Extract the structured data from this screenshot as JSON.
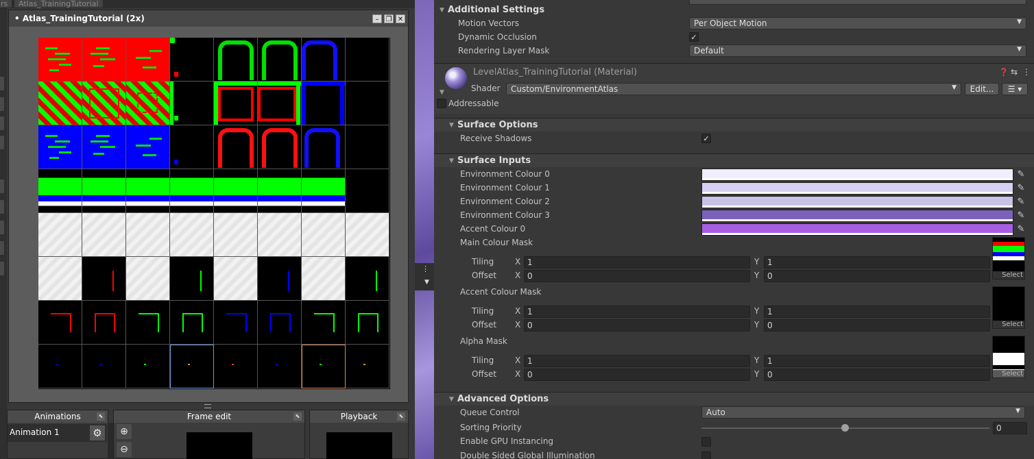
{
  "left_editor": {
    "top_tabs": [
      "rs",
      "Atlas_TrainingTutorial"
    ],
    "window_title": "• Atlas_TrainingTutorial   (2x)",
    "window_buttons": [
      "minimize-icon",
      "restore-icon",
      "close-icon"
    ],
    "panels": {
      "animations": {
        "title": "Animations",
        "item": "Animation 1"
      },
      "frame_edit": {
        "title": "Frame edit"
      },
      "playback": {
        "title": "Playback"
      }
    }
  },
  "inspector": {
    "additional_settings": {
      "title": "Additional Settings",
      "motion_vectors": {
        "label": "Motion Vectors",
        "value": "Per Object Motion"
      },
      "dynamic_occlusion": {
        "label": "Dynamic Occlusion",
        "checked": true
      },
      "rendering_layer_mask": {
        "label": "Rendering Layer Mask",
        "value": "Default"
      }
    },
    "material": {
      "name": "LevelAtlas_TrainingTutorial (Material)",
      "shader_label": "Shader",
      "shader_value": "Custom/EnvironmentAtlas",
      "edit_label": "Edit...",
      "addressable_label": "Addressable"
    },
    "surface_options": {
      "title": "Surface Options",
      "receive_shadows": {
        "label": "Receive Shadows",
        "checked": true
      }
    },
    "surface_inputs": {
      "title": "Surface Inputs",
      "colours": [
        {
          "label": "Environment Colour 0",
          "color": "#f0eefe"
        },
        {
          "label": "Environment Colour 1",
          "color": "#d6d0f2"
        },
        {
          "label": "Environment Colour 2",
          "color": "#c8c2e6"
        },
        {
          "label": "Environment Colour 3",
          "color": "#7a62b8"
        },
        {
          "label": "Accent Colour 0",
          "color": "#a85ee0"
        }
      ],
      "masks": [
        {
          "label": "Main Colour Mask",
          "tiling_label": "Tiling",
          "offset_label": "Offset",
          "tiling_x": "1",
          "tiling_y": "1",
          "offset_x": "0",
          "offset_y": "0",
          "select_label": "Select"
        },
        {
          "label": "Accent Colour Mask",
          "tiling_label": "Tiling",
          "offset_label": "Offset",
          "tiling_x": "1",
          "tiling_y": "1",
          "offset_x": "0",
          "offset_y": "0",
          "select_label": "Select"
        },
        {
          "label": "Alpha Mask",
          "tiling_label": "Tiling",
          "offset_label": "Offset",
          "tiling_x": "1",
          "tiling_y": "1",
          "offset_x": "0",
          "offset_y": "0",
          "select_label": "Select"
        }
      ],
      "x_label": "X",
      "y_label": "Y"
    },
    "advanced_options": {
      "title": "Advanced Options",
      "queue_control": {
        "label": "Queue Control",
        "value": "Auto"
      },
      "sorting_priority": {
        "label": "Sorting Priority",
        "value": "0"
      },
      "gpu_instancing": {
        "label": "Enable GPU Instancing",
        "checked": false
      },
      "double_sided_gi": {
        "label": "Double Sided Global Illumination",
        "checked": false
      }
    }
  }
}
